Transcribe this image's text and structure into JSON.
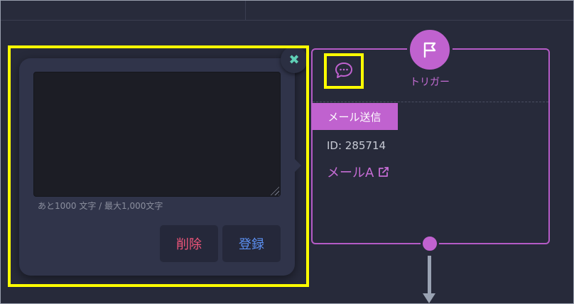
{
  "memo": {
    "text_value": "",
    "char_count": "あと1000 文字 / 最大1,000文字",
    "delete_label": "削除",
    "save_label": "登録",
    "close_icon": "✖"
  },
  "node": {
    "trigger_label": "トリガー",
    "action_label": "メール送信",
    "id_text": "ID: 285714",
    "mail_link_label": "メールA"
  },
  "icons": {
    "close": "close-icon",
    "flag": "flag-icon",
    "comment": "comment-icon",
    "external_link": "external-link-icon"
  },
  "colors": {
    "accent_purple": "#c062cf",
    "highlight_yellow": "#ffff00",
    "delete_red": "#f0557a",
    "save_blue": "#5b8ff0",
    "close_teal": "#5fd0b6"
  }
}
